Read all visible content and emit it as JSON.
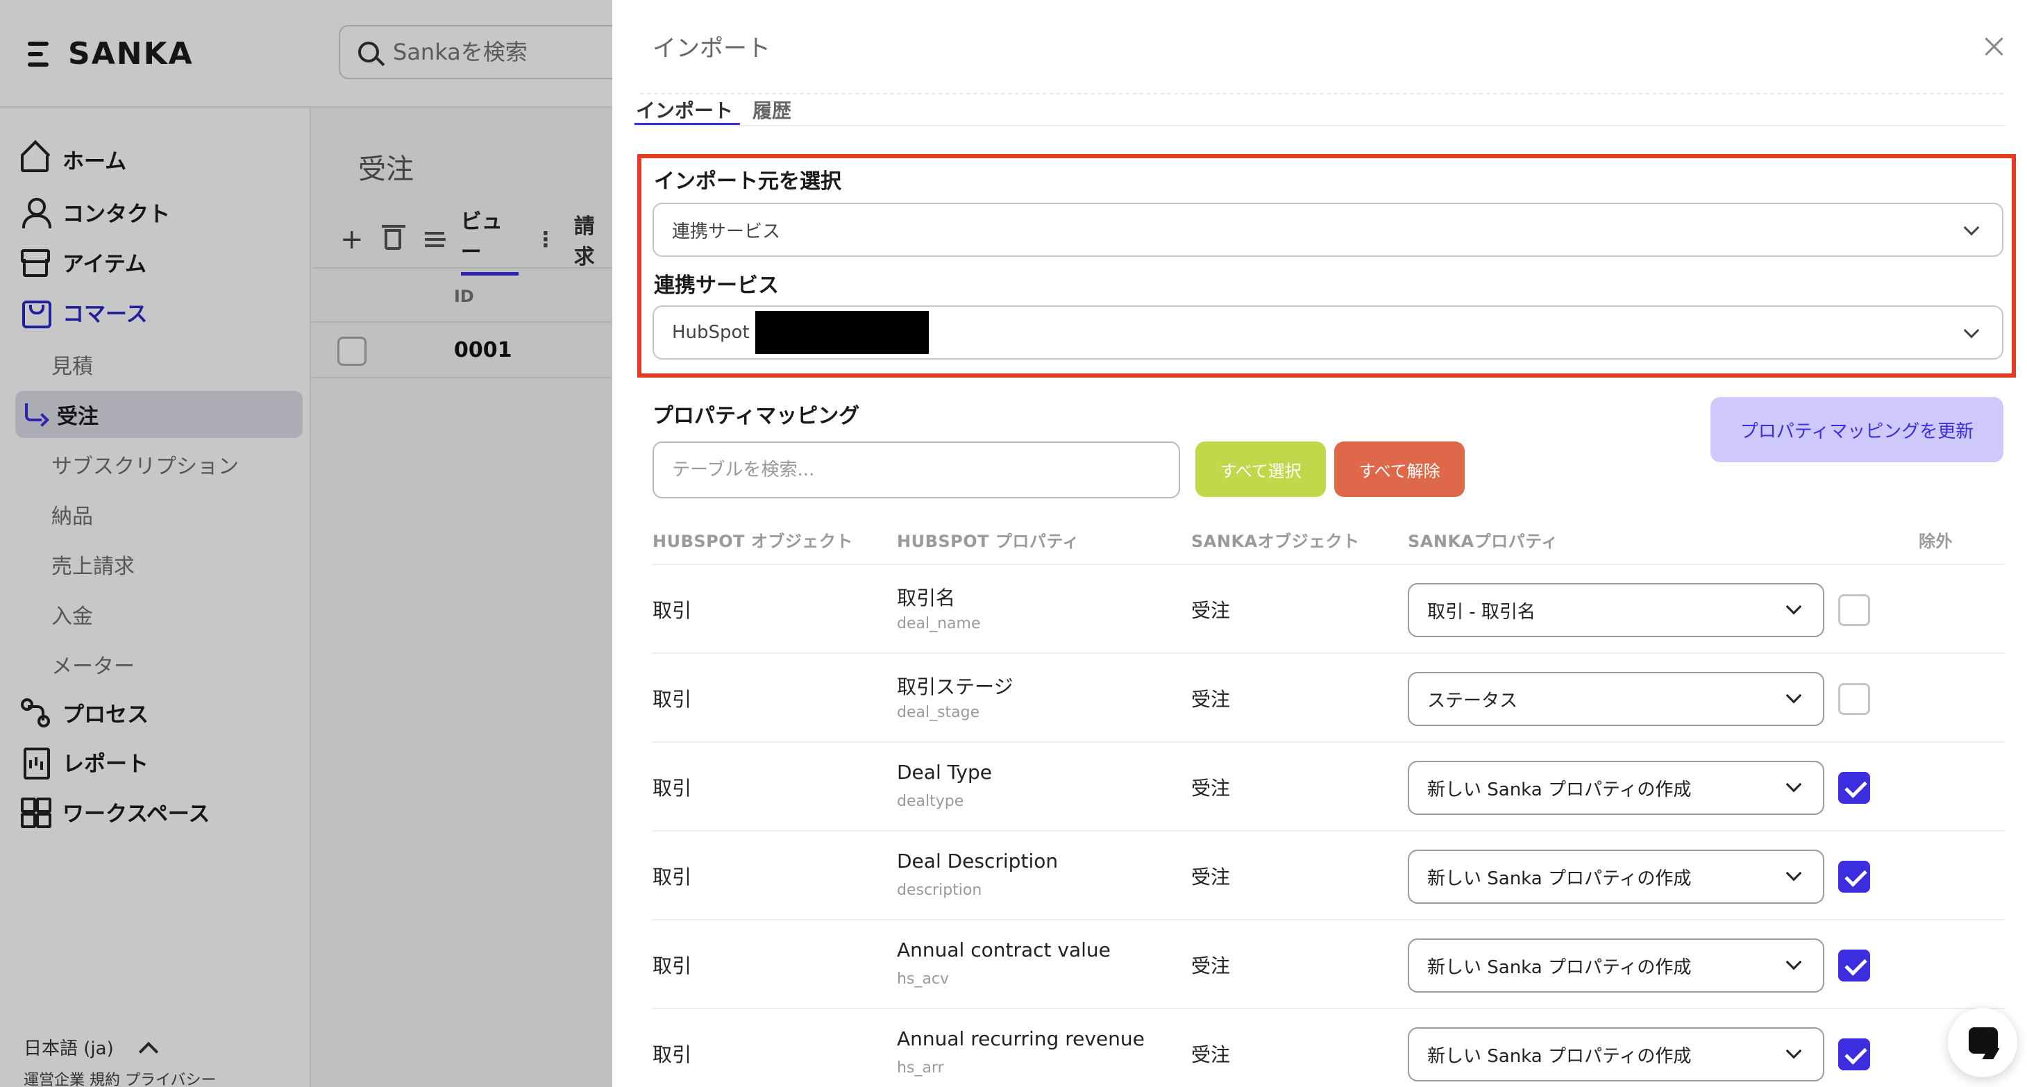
{
  "app": {
    "brand": "SANKA",
    "search_placeholder": "Sankaを検索",
    "nav": {
      "home": "ホーム",
      "contacts": "コンタクト",
      "items": "アイテム",
      "commerce": "コマース",
      "commerce_sub": [
        "見積",
        "受注",
        "サブスクリプション",
        "納品",
        "売上請求",
        "入金",
        "メーター"
      ],
      "process": "プロセス",
      "report": "レポート",
      "workspace": "ワークスペース"
    },
    "language": "日本語 (ja)",
    "footer": "運営企業 規約 プライバシー",
    "page_title": "受注",
    "toolbar": {
      "plus": "+",
      "view": "ビュー",
      "more": "⋮",
      "billing": "請求"
    },
    "table": {
      "id_header": "ID",
      "rows": [
        "0001"
      ]
    }
  },
  "panel": {
    "title": "インポート",
    "tabs": [
      "インポート",
      "履歴"
    ],
    "source_label": "インポート元を選択",
    "source_value": "連携サービス",
    "integration_label": "連携サービス",
    "integration_value": "HubSpot",
    "mapping_label": "プロパティマッピング",
    "update_button": "プロパティマッピングを更新",
    "table_search_placeholder": "テーブルを検索...",
    "select_all": "すべて選択",
    "clear_all": "すべて解除",
    "columns": [
      "HUBSPOT オブジェクト",
      "HUBSPOT プロパティ",
      "SANKAオブジェクト",
      "SANKAプロパティ",
      "除外"
    ],
    "rows": [
      {
        "object": "取引",
        "property": "取引名",
        "code": "deal_name",
        "sanka_object": "受注",
        "sanka_property": "取引 - 取引名",
        "excluded": false
      },
      {
        "object": "取引",
        "property": "取引ステージ",
        "code": "deal_stage",
        "sanka_object": "受注",
        "sanka_property": "ステータス",
        "excluded": false
      },
      {
        "object": "取引",
        "property": "Deal Type",
        "code": "dealtype",
        "sanka_object": "受注",
        "sanka_property": "新しい Sanka プロパティの作成",
        "excluded": true
      },
      {
        "object": "取引",
        "property": "Deal Description",
        "code": "description",
        "sanka_object": "受注",
        "sanka_property": "新しい Sanka プロパティの作成",
        "excluded": true
      },
      {
        "object": "取引",
        "property": "Annual contract value",
        "code": "hs_acv",
        "sanka_object": "受注",
        "sanka_property": "新しい Sanka プロパティの作成",
        "excluded": true
      },
      {
        "object": "取引",
        "property": "Annual recurring revenue",
        "code": "hs_arr",
        "sanka_object": "受注",
        "sanka_property": "新しい Sanka プロパティの作成",
        "excluded": true
      }
    ]
  },
  "colors": {
    "accent": "#3b2ee0",
    "highlight_border": "#e53a24",
    "select_all_bg": "#c1d84a",
    "clear_all_bg": "#e0684a",
    "update_bg": "#cfc8fb"
  }
}
